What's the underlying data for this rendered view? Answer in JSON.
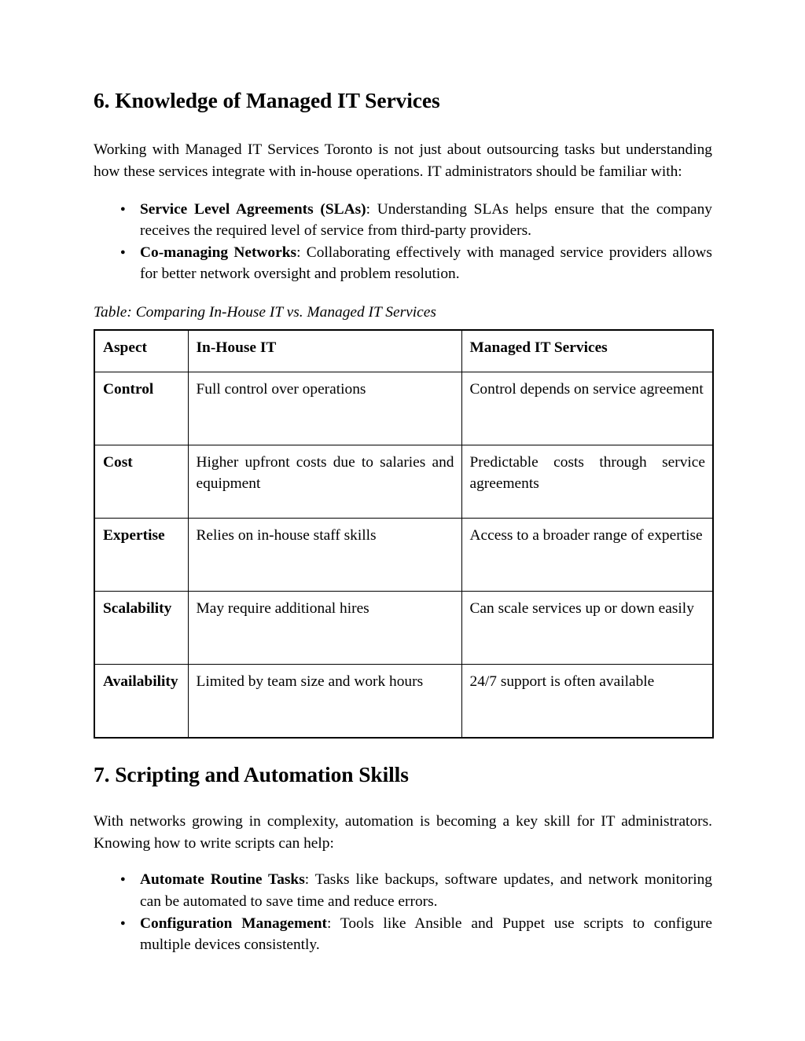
{
  "document": {
    "sections": [
      {
        "heading": "6. Knowledge of Managed IT Services",
        "paragraph": "Working with Managed IT Services Toronto is not just about outsourcing tasks but understanding how these services integrate with in-house operations. IT administrators should be familiar with:",
        "bullets": [
          {
            "lead": "Service Level Agreements (SLAs)",
            "rest": ": Understanding SLAs helps ensure that the company receives the required level of service from third-party providers."
          },
          {
            "lead": "Co-managing Networks",
            "rest": ": Collaborating effectively with managed service providers allows for better network oversight and problem resolution."
          }
        ]
      },
      {
        "heading": "7. Scripting and Automation Skills",
        "paragraph": "With networks growing in complexity, automation is becoming a key skill for IT administrators. Knowing how to write scripts can help:",
        "bullets": [
          {
            "lead": "Automate Routine Tasks",
            "rest": ": Tasks like backups, software updates, and network monitoring can be automated to save time and reduce errors."
          },
          {
            "lead": "Configuration Management",
            "rest": ": Tools like Ansible and Puppet use scripts to configure multiple devices consistently."
          }
        ]
      }
    ],
    "table": {
      "caption": "Table: Comparing In-House IT vs. Managed IT Services",
      "headers": [
        "Aspect",
        "In-House IT",
        "Managed IT Services"
      ],
      "rows": [
        {
          "aspect": "Control",
          "in_house": "Full control over operations",
          "managed": "Control depends on service agreement"
        },
        {
          "aspect": "Cost",
          "in_house": "Higher upfront costs due to salaries and equipment",
          "managed": "Predictable costs through service agreements"
        },
        {
          "aspect": "Expertise",
          "in_house": "Relies on in-house staff skills",
          "managed": "Access to a broader range of expertise"
        },
        {
          "aspect": "Scalability",
          "in_house": "May require additional hires",
          "managed": "Can scale services up or down easily"
        },
        {
          "aspect": "Availability",
          "in_house": "Limited by team size and work hours",
          "managed": "24/7 support is often available"
        }
      ]
    }
  }
}
